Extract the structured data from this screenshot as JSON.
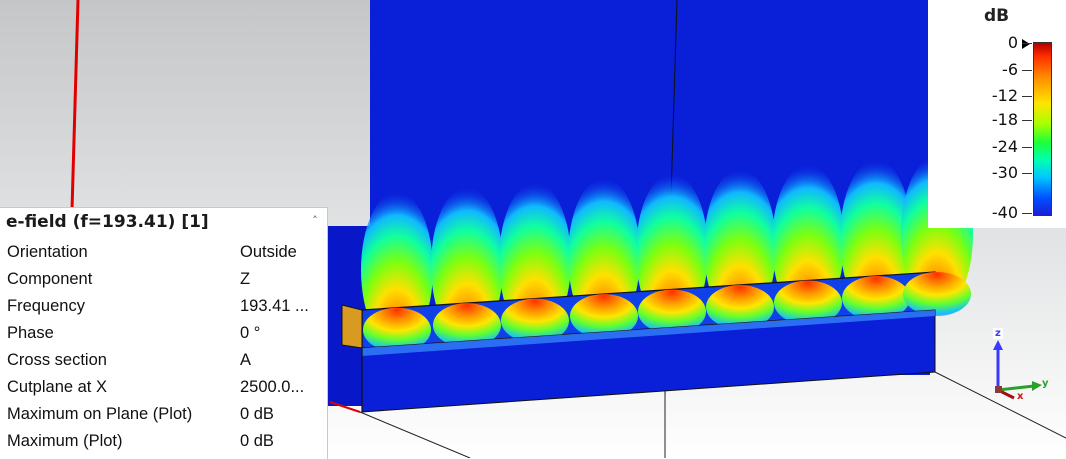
{
  "legend": {
    "unit": "dB",
    "ticks": [
      "0",
      "-6",
      "-12",
      "-18",
      "-24",
      "-30",
      "-40"
    ]
  },
  "panel": {
    "title": "e-field (f=193.41) [1]",
    "collapse_icon": "chevron-up-icon",
    "rows": [
      {
        "name": "Orientation",
        "value": "Outside"
      },
      {
        "name": "Component",
        "value": "Z"
      },
      {
        "name": "Frequency",
        "value": "193.41 ..."
      },
      {
        "name": "Phase",
        "value": "0 °"
      },
      {
        "name": "Cross section",
        "value": "A"
      },
      {
        "name": "Cutplane at X",
        "value": "2500.0..."
      },
      {
        "name": "Maximum on Plane (Plot)",
        "value": "0 dB"
      },
      {
        "name": "Maximum (Plot)",
        "value": "0 dB"
      }
    ]
  },
  "triad": {
    "z_label": "z",
    "y_label": "y",
    "x_label": "x",
    "z_color": "#3a3aff",
    "y_color": "#2aa02a",
    "x_color": "#d01010"
  },
  "colors": {
    "field_low": "#0a1fd8",
    "field_high": "#ff2800",
    "background_top": "#c4c6c8",
    "background_bottom": "#ffffff",
    "axis_red": "#e00000"
  }
}
